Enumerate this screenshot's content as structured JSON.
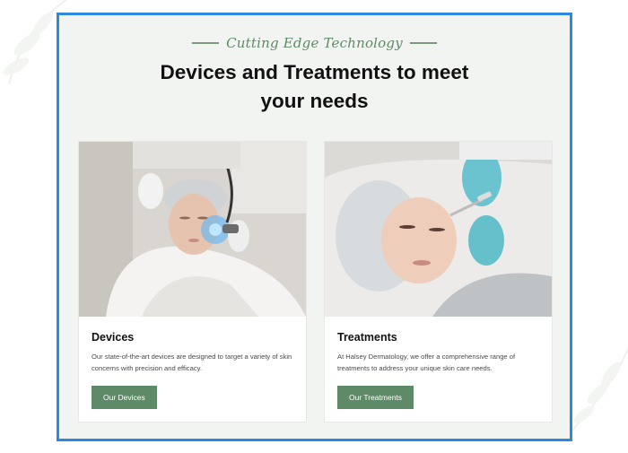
{
  "section": {
    "eyebrow": "Cutting Edge Technology",
    "heading_line1": "Devices and Treatments to meet",
    "heading_line2": "your needs"
  },
  "cards": [
    {
      "title": "Devices",
      "description": "Our state-of-the-art devices are designed to target a variety of skin concerns with precision and efficacy.",
      "button_label": "Our Devices",
      "image_icon": "photo-devices"
    },
    {
      "title": "Treatments",
      "description": "At Halsey Dermatology, we offer a comprehensive range of treatments to address your unique skin care needs.",
      "button_label": "Our Treatments",
      "image_icon": "photo-treatments"
    }
  ],
  "colors": {
    "frame_border": "#2b8ae0",
    "background": "#f1f4f0",
    "accent": "#5f8a68",
    "heading": "#111111"
  }
}
